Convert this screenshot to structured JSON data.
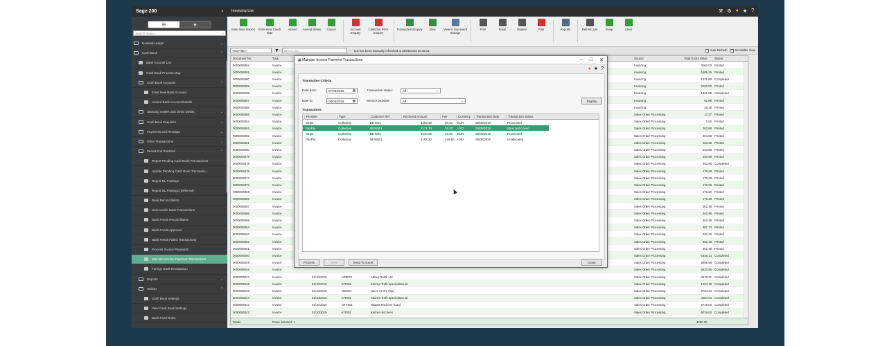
{
  "app": {
    "name": "Sage 200",
    "window_title": "Invoicing List"
  },
  "sidebar": {
    "search_placeholder": "Search menu...",
    "items": [
      {
        "label": "Nominal Ledger",
        "level": 0,
        "kind": "folder",
        "chev": "v"
      },
      {
        "label": "Cash Book",
        "level": 0,
        "kind": "folder",
        "chev": "^"
      },
      {
        "label": "Bank Account List",
        "level": 1,
        "kind": "item"
      },
      {
        "label": "Cash Book Process Map",
        "level": 1,
        "kind": "item"
      },
      {
        "label": "Cash Book Accounts",
        "level": 1,
        "kind": "folder",
        "chev": "^"
      },
      {
        "label": "Enter New Bank Account",
        "level": 2,
        "kind": "item"
      },
      {
        "label": "Amend Bank Account Details",
        "level": 2,
        "kind": "item"
      },
      {
        "label": "Standing Orders and Direct Debits",
        "level": 1,
        "kind": "folder",
        "chev": "v"
      },
      {
        "label": "Cash Book Enquiries",
        "level": 1,
        "kind": "folder",
        "chev": "v"
      },
      {
        "label": "Payments and Receipts",
        "level": 1,
        "kind": "folder",
        "chev": "v"
      },
      {
        "label": "Other Transactions",
        "level": 1,
        "kind": "folder",
        "chev": "v"
      },
      {
        "label": "Period End Routines",
        "level": 1,
        "kind": "folder",
        "chev": "^"
      },
      {
        "label": "Report Pending Cash Book Transactions",
        "level": 2,
        "kind": "item"
      },
      {
        "label": "Update Pending Cash Book Transactio...",
        "level": 2,
        "kind": "item"
      },
      {
        "label": "Report NL Postings",
        "level": 2,
        "kind": "item"
      },
      {
        "label": "Report NL Postings (Deferred)",
        "level": 2,
        "kind": "item"
      },
      {
        "label": "Bank Reconciliation",
        "level": 2,
        "kind": "item"
      },
      {
        "label": "Unreconcile Bank Transactions",
        "level": 2,
        "kind": "item"
      },
      {
        "label": "Bank Feeds Reconciliation",
        "level": 2,
        "kind": "item"
      },
      {
        "label": "Bank Feeds Approval",
        "level": 2,
        "kind": "item"
      },
      {
        "label": "Bank Feeds Failed Transactions",
        "level": 2,
        "kind": "item"
      },
      {
        "label": "Process Invoice Payments",
        "level": 2,
        "kind": "item"
      },
      {
        "label": "Maintain Invoice Payment Transactions",
        "level": 2,
        "kind": "item",
        "selected": true
      },
      {
        "label": "Foreign Bank Revaluation",
        "level": 2,
        "kind": "item"
      },
      {
        "label": "Reports",
        "level": 1,
        "kind": "folder",
        "chev": "v"
      },
      {
        "label": "Utilities",
        "level": 1,
        "kind": "folder",
        "chev": "^"
      },
      {
        "label": "Cash Book Settings",
        "level": 2,
        "kind": "item"
      },
      {
        "label": "View Cash Book Settings",
        "level": 2,
        "kind": "item"
      },
      {
        "label": "Bank Feed Rules",
        "level": 2,
        "kind": "item"
      }
    ]
  },
  "ribbon": [
    {
      "label": "Enter New Invoice",
      "color": "#3a9a3a"
    },
    {
      "label": "Enter New Credit Note",
      "color": "#3a9a3a"
    },
    {
      "label": "Amend",
      "color": "#3a9a3a"
    },
    {
      "label": "Amend Status",
      "color": "#3a9a3a"
    },
    {
      "label": "Cancel",
      "color": "#3a9a3a"
    },
    {
      "label": "Account Enquiry",
      "color": "#cc3333"
    },
    {
      "label": "Customer Price Enquiry",
      "color": "#cc3333"
    },
    {
      "label": "Transaction Enquiry",
      "color": "#3a8a4a"
    },
    {
      "label": "View",
      "color": "#3a8a4a"
    },
    {
      "label": "View in Document Storage",
      "color": "#5a7a9a"
    },
    {
      "label": "Print",
      "color": "#555555"
    },
    {
      "label": "Email",
      "color": "#555555"
    },
    {
      "label": "Reprint",
      "color": "#555555"
    },
    {
      "label": "Post",
      "color": "#cc3333"
    },
    {
      "label": "Reports",
      "color": "#5a6a7a"
    },
    {
      "label": "Refresh List",
      "color": "#555555"
    },
    {
      "label": "Swap",
      "color": "#3a9a3a"
    },
    {
      "label": "Clear",
      "color": "#3a9a3a"
    }
  ],
  "filter": {
    "filter_value": "<No Filter>",
    "search_placeholder": "Search list...",
    "message": "List has been manually refreshed at 08/05/2018 10:15:31",
    "auto_refresh": "Auto Refresh",
    "scrollable_view": "Scrollable View"
  },
  "grid": {
    "headers": [
      "Document No.",
      "Type",
      "Source",
      "Total Gross Value",
      "Status"
    ],
    "rows": [
      {
        "doc": "0000006092",
        "type": "Invoice",
        "date": "",
        "ref": "",
        "name": "",
        "source": "Invoicing",
        "value": "4260.00",
        "status": "Printed"
      },
      {
        "doc": "0000006091",
        "type": "Invoice",
        "date": "",
        "ref": "",
        "name": "",
        "source": "Invoicing",
        "value": "1686.25",
        "status": "Printed"
      },
      {
        "doc": "0000006090",
        "type": "Invoice",
        "date": "",
        "ref": "",
        "name": "",
        "source": "Invoicing",
        "value": "1321.88",
        "status": "Completed"
      },
      {
        "doc": "0000006089",
        "type": "Invoice",
        "date": "",
        "ref": "",
        "name": "",
        "source": "Invoicing",
        "value": "2260.00",
        "status": "Printed"
      },
      {
        "doc": "0000006088",
        "type": "Invoice",
        "date": "",
        "ref": "",
        "name": "",
        "source": "Invoicing",
        "value": "1321.88",
        "status": "Completed"
      },
      {
        "doc": "0000006087",
        "type": "Invoice",
        "date": "",
        "ref": "",
        "name": "",
        "source": "Invoicing",
        "value": "62.88",
        "status": "Printed"
      },
      {
        "doc": "0000006086",
        "type": "Invoice",
        "date": "",
        "ref": "",
        "name": "",
        "source": "Invoicing",
        "value": "49.38",
        "status": "Printed"
      },
      {
        "doc": "0000006085",
        "type": "Invoice",
        "date": "",
        "ref": "",
        "name": "",
        "source": "Sales Order Processing",
        "value": "17.27",
        "status": "Printed"
      },
      {
        "doc": "0000006084",
        "type": "Invoice",
        "date": "",
        "ref": "",
        "name": "",
        "source": "Sales Order Processing",
        "value": "0.00",
        "status": "Printed"
      },
      {
        "doc": "0000006083",
        "type": "Invoice",
        "date": "",
        "ref": "",
        "name": "",
        "source": "Sales Order Processing",
        "value": "263.68",
        "status": "Printed"
      },
      {
        "doc": "0000006082",
        "type": "Invoice",
        "date": "",
        "ref": "",
        "name": "",
        "source": "Sales Order Processing",
        "value": "263.68",
        "status": "Printed"
      },
      {
        "doc": "0000006081",
        "type": "Invoice",
        "date": "",
        "ref": "",
        "name": "",
        "source": "Sales Order Processing",
        "value": "263.68",
        "status": "Printed"
      },
      {
        "doc": "0000006080",
        "type": "Invoice",
        "date": "",
        "ref": "",
        "name": "",
        "source": "Sales Order Processing",
        "value": "263.68",
        "status": "Printed"
      },
      {
        "doc": "0000006079",
        "type": "Invoice",
        "date": "",
        "ref": "",
        "name": "",
        "source": "Sales Order Processing",
        "value": "263.68",
        "status": "Printed"
      },
      {
        "doc": "0000006078",
        "type": "Invoice",
        "date": "",
        "ref": "",
        "name": "",
        "source": "Sales Order Processing",
        "value": "263.68",
        "status": "Completed"
      },
      {
        "doc": "0000006076",
        "type": "Invoice",
        "date": "",
        "ref": "",
        "name": "",
        "source": "Sales Order Processing",
        "value": "176.28",
        "status": "Printed"
      },
      {
        "doc": "0000006074",
        "type": "Invoice",
        "date": "",
        "ref": "",
        "name": "",
        "source": "Sales Order Processing",
        "value": "176.28",
        "status": "Printed"
      },
      {
        "doc": "0000006073",
        "type": "Invoice",
        "date": "",
        "ref": "",
        "name": "",
        "source": "Sales Order Processing",
        "value": "176.28",
        "status": "Printed"
      },
      {
        "doc": "0000006069",
        "type": "Invoice",
        "date": "",
        "ref": "",
        "name": "",
        "source": "Sales Order Processing",
        "value": "176.28",
        "status": "Printed"
      },
      {
        "doc": "0000006068",
        "type": "Invoice",
        "date": "",
        "ref": "",
        "name": "",
        "source": "Sales Order Processing",
        "value": "176.28",
        "status": "Printed"
      },
      {
        "doc": "0000006067",
        "type": "Invoice",
        "date": "",
        "ref": "",
        "name": "",
        "source": "Sales Order Processing",
        "value": "362.48",
        "status": "Printed"
      },
      {
        "doc": "0000006066",
        "type": "Invoice",
        "date": "",
        "ref": "",
        "name": "",
        "source": "Sales Order Processing",
        "value": "362.48",
        "status": "Printed"
      },
      {
        "doc": "0000006065",
        "type": "Invoice",
        "date": "",
        "ref": "",
        "name": "",
        "source": "Sales Order Processing",
        "value": "362.48",
        "status": "Printed"
      },
      {
        "doc": "0000006064",
        "type": "Invoice",
        "date": "",
        "ref": "",
        "name": "",
        "source": "Sales Order Processing",
        "value": "387.73",
        "status": "Printed"
      },
      {
        "doc": "0000006063",
        "type": "Invoice",
        "date": "",
        "ref": "",
        "name": "",
        "source": "Sales Order Processing",
        "value": "362.48",
        "status": "Printed"
      },
      {
        "doc": "0000006062",
        "type": "Invoice",
        "date": "",
        "ref": "",
        "name": "",
        "source": "Sales Order Processing",
        "value": "362.48",
        "status": "Printed"
      },
      {
        "doc": "0000006061",
        "type": "Invoice",
        "date": "",
        "ref": "",
        "name": "",
        "source": "Sales Order Processing",
        "value": "362.48",
        "status": "Printed"
      },
      {
        "doc": "0000006050",
        "type": "Invoice",
        "date": "",
        "ref": "",
        "name": "",
        "source": "Sales Order Processing",
        "value": "6440.14",
        "status": "Completed"
      },
      {
        "doc": "0000006049",
        "type": "Invoice",
        "date": "",
        "ref": "",
        "name": "",
        "source": "Sales Order Processing",
        "value": "5656.58",
        "status": "Completed"
      },
      {
        "doc": "0000006048",
        "type": "Invoice",
        "date": "",
        "ref": "",
        "name": "",
        "source": "Sales Order Processing",
        "value": "5620.96",
        "status": "Completed"
      },
      {
        "doc": "0000006047",
        "type": "Invoice",
        "date": "01/10/2010",
        "ref": "AB8001",
        "name": "Abbey Retail Ltd",
        "source": "Sales Order Processing",
        "value": "3278.21",
        "status": "Completed"
      },
      {
        "doc": "0000006046",
        "type": "Invoice",
        "date": "01/10/2010",
        "ref": "KIT001",
        "name": "Kitchen Refit Specialists Ltd",
        "source": "Sales Order Processing",
        "value": "1404.18",
        "status": "Completed"
      },
      {
        "doc": "0000006045",
        "type": "Invoice",
        "date": "01/10/2010",
        "ref": "NIE001",
        "name": "Nieve et Oro (Sp)",
        "source": "Sales Order Processing",
        "value": "2764.44",
        "status": "Completed"
      },
      {
        "doc": "0000006044",
        "type": "Invoice",
        "date": "01/10/2010",
        "ref": "KIT001",
        "name": "Kitchen Refit Specialists Ltd",
        "source": "Sales Order Processing",
        "value": "4484.04",
        "status": "Completed"
      },
      {
        "doc": "0000006043",
        "type": "Invoice",
        "date": "01/10/2010",
        "ref": "OTT001",
        "name": "Ottawa Kitchens (Can)",
        "source": "Sales Order Processing",
        "value": "6749.03",
        "status": "Completed"
      },
      {
        "doc": "0000006042",
        "type": "Invoice",
        "date": "01/10/2010",
        "ref": "KIT002",
        "name": "Kitchen Kitchens",
        "source": "Sales Order Processing",
        "value": "6076.63",
        "status": "Completed"
      },
      {
        "doc": "0000006041",
        "type": "Invoice",
        "date": "01/10/2010",
        "ref": "BIR004",
        "name": "Cute and Cosey Kitsch",
        "source": "Sales Order Processing",
        "value": "3511.00",
        "status": "Completed"
      }
    ],
    "totals_label": "Totals",
    "rows_selected": "Rows selected: 1",
    "total_value": "4260.00"
  },
  "dialog": {
    "title": "Maintain Invoice Payment Transactions",
    "criteria_heading": "Transaction Criteria",
    "date_from_label": "Date from:",
    "date_from": "07/05/2018",
    "date_to_label": "Date to:",
    "date_to": "08/05/2018",
    "status_label": "Transaction status:",
    "status_value": "All",
    "provider_label": "Service provider:",
    "provider_value": "All",
    "display_btn": "Display",
    "transactions_heading": "Transactions",
    "columns": [
      "Provider",
      "Type",
      "Customer Ref",
      "Received Amount",
      "Fee",
      "Currency",
      "Transaction Date",
      "Transaction Status"
    ],
    "rows": [
      {
        "provider": "Stripe",
        "type": "Collection",
        "ref": "BET001",
        "amount": "1263.38",
        "fee": "36.63",
        "currency": "EUR",
        "date": "08/05/2018",
        "status": "Processed"
      },
      {
        "provider": "PayPal",
        "type": "Collection",
        "ref": "NEW001",
        "amount": "2171.70",
        "fee": "76.10",
        "currency": "USD",
        "date": "08/05/2018",
        "status": "Bank Not Found",
        "selected": true
      },
      {
        "provider": "Stripe",
        "type": "Collection",
        "ref": "BET001",
        "amount": "1640.08",
        "fee": "46.20",
        "currency": "EUR",
        "date": "08/05/2018",
        "status": "Processed"
      },
      {
        "provider": "PayPal",
        "type": "Collection",
        "ref": "NEW001",
        "amount": "4108.20",
        "fee": "144.80",
        "currency": "USD",
        "date": "08/05/2018",
        "status": "Unallocated"
      }
    ],
    "process_btn": "Process",
    "view_btn": "View",
    "excel_btn": "Send To Excel",
    "close_btn": "Close"
  }
}
